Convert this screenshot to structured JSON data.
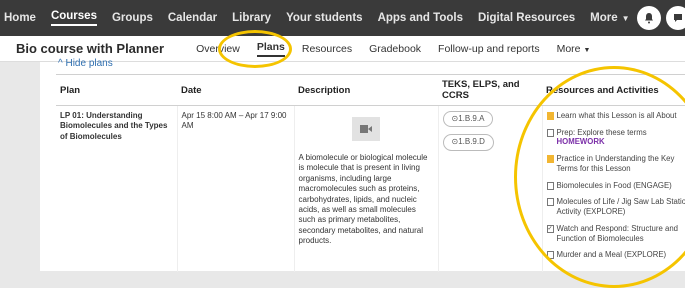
{
  "topnav": {
    "items": [
      "Home",
      "Courses",
      "Groups",
      "Calendar",
      "Library",
      "Your students",
      "Apps and Tools",
      "Digital Resources",
      "More"
    ]
  },
  "subnav": {
    "course_title": "Bio course with Planner",
    "tabs": [
      "Overview",
      "Plans",
      "Resources",
      "Gradebook",
      "Follow-up and reports",
      "More"
    ]
  },
  "hide_plans": "Hide plans",
  "table": {
    "headers": [
      "Plan",
      "Date",
      "Description",
      "TEKS, ELPS, and CCRS",
      "Resources and Activities"
    ],
    "row": {
      "plan": "LP 01: Understanding Biomolecules and the Types of Biomolecules",
      "date": "Apr 15 8:00 AM – Apr 17 9:00 AM",
      "description": "A biomolecule or biological molecule is molecule that is present in living organisms, including large macromolecules such as proteins, carbohydrates, lipids, and nucleic acids, as well as small molecules such as primary metabolites, secondary metabolites, and natural products.",
      "teks": [
        "1.B.9.A",
        "1.B.9.D"
      ],
      "resources": [
        {
          "icon": "yellow-doc-icon",
          "text": "Learn what this Lesson is all About"
        },
        {
          "icon": "doc-icon",
          "text": "Prep: Explore these terms ",
          "extra": "HOMEWORK"
        },
        {
          "icon": "yellow-doc-icon",
          "text": "Practice in Understanding the Key Terms for this Lesson"
        },
        {
          "icon": "doc-icon",
          "text": "Biomolecules in Food (ENGAGE)"
        },
        {
          "icon": "doc-icon",
          "text": "Molecules of Life / Jig Saw Lab Station Activity (EXPLORE)"
        },
        {
          "icon": "check-icon",
          "text": "Watch and Respond: Structure and Function of Biomolecules"
        },
        {
          "icon": "doc-icon",
          "text": "Murder and a Meal (EXPLORE)"
        }
      ]
    }
  }
}
